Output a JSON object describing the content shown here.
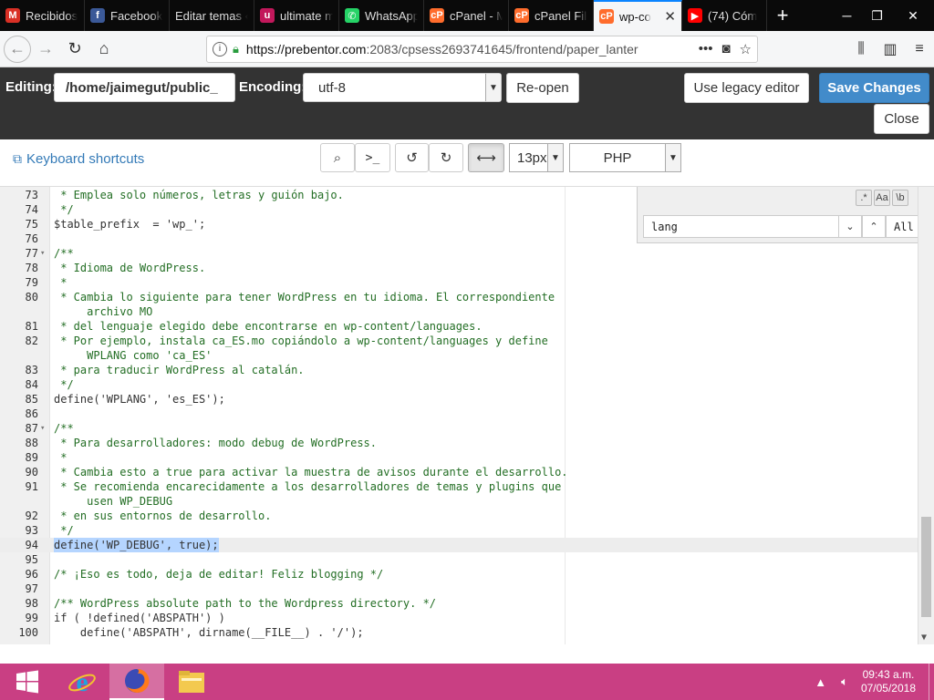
{
  "browser": {
    "tabs": [
      {
        "label": "Recibidos",
        "icon": "gmail-icon",
        "color": "#d93025",
        "glyph": "M"
      },
      {
        "label": "Facebook",
        "icon": "facebook-icon",
        "color": "#3b5998",
        "glyph": "f"
      },
      {
        "label": "Editar temas ‹",
        "icon": "",
        "color": "",
        "glyph": ""
      },
      {
        "label": "ultimate m",
        "icon": "ultimate-icon",
        "color": "#c2185b",
        "glyph": "u"
      },
      {
        "label": "WhatsApp",
        "icon": "whatsapp-icon",
        "color": "#25d366",
        "glyph": "✆"
      },
      {
        "label": "cPanel - M",
        "icon": "cpanel-icon",
        "color": "#ff6c2c",
        "glyph": "cP"
      },
      {
        "label": "cPanel File",
        "icon": "cpanel-icon",
        "color": "#ff6c2c",
        "glyph": "cP"
      },
      {
        "label": "wp-co",
        "icon": "cpanel-icon",
        "color": "#ff6c2c",
        "glyph": "cP",
        "active": true
      },
      {
        "label": "(74) Cóm",
        "icon": "youtube-icon",
        "color": "#ff0000",
        "glyph": "▶"
      }
    ],
    "url_host": "https://prebentor.com",
    "url_rest": ":2083/cpsess2693741645/frontend/paper_lanter"
  },
  "editor_header": {
    "editing_label": "Editing:",
    "path_value": "/home/jaimegut/public_",
    "encoding_label": "Encoding:",
    "encoding_value": "utf-8",
    "reopen_label": "Re-open",
    "legacy_label": "Use legacy editor",
    "save_label": "Save Changes",
    "close_label": "Close"
  },
  "toolbar": {
    "shortcuts_label": "Keyboard shortcuts",
    "fontsize_value": "13px",
    "mode_value": "PHP"
  },
  "search": {
    "regex_label": ".*",
    "case_label": "Aa",
    "word_label": "\\b",
    "query": "lang",
    "all_label": "All"
  },
  "code_lines": [
    {
      "num": "73",
      "text": " * Emplea solo números, letras y guión bajo."
    },
    {
      "num": "74",
      "text": " */"
    },
    {
      "num": "75",
      "text": "$table_prefix  = 'wp_';"
    },
    {
      "num": "76",
      "text": ""
    },
    {
      "num": "77",
      "text": "/**",
      "fold": true
    },
    {
      "num": "78",
      "text": " * Idioma de WordPress."
    },
    {
      "num": "79",
      "text": " *"
    },
    {
      "num": "80",
      "text": " * Cambia lo siguiente para tener WordPress en tu idioma. El correspondiente"
    },
    {
      "num": "",
      "text": "     archivo MO"
    },
    {
      "num": "81",
      "text": " * del lenguaje elegido debe encontrarse en wp-content/languages."
    },
    {
      "num": "82",
      "text": " * Por ejemplo, instala ca_ES.mo copiándolo a wp-content/languages y define"
    },
    {
      "num": "",
      "text": "     WPLANG como 'ca_ES'"
    },
    {
      "num": "83",
      "text": " * para traducir WordPress al catalán."
    },
    {
      "num": "84",
      "text": " */"
    },
    {
      "num": "85",
      "text": "define('WPLANG', 'es_ES');"
    },
    {
      "num": "86",
      "text": ""
    },
    {
      "num": "87",
      "text": "/**",
      "fold": true
    },
    {
      "num": "88",
      "text": " * Para desarrolladores: modo debug de WordPress."
    },
    {
      "num": "89",
      "text": " *"
    },
    {
      "num": "90",
      "text": " * Cambia esto a true para activar la muestra de avisos durante el desarrollo."
    },
    {
      "num": "91",
      "text": " * Se recomienda encarecidamente a los desarrolladores de temas y plugins que"
    },
    {
      "num": "",
      "text": "     usen WP_DEBUG"
    },
    {
      "num": "92",
      "text": " * en sus entornos de desarrollo."
    },
    {
      "num": "93",
      "text": " */"
    },
    {
      "num": "94",
      "text": "define('WP_DEBUG', true);",
      "highlight": true
    },
    {
      "num": "95",
      "text": ""
    },
    {
      "num": "96",
      "text": "/* ¡Eso es todo, deja de editar! Feliz blogging */"
    },
    {
      "num": "97",
      "text": ""
    },
    {
      "num": "98",
      "text": "/** WordPress absolute path to the Wordpress directory. */"
    },
    {
      "num": "99",
      "text": "if ( !defined('ABSPATH') )"
    },
    {
      "num": "100",
      "text": "    define('ABSPATH', dirname(__FILE__) . '/');"
    }
  ],
  "taskbar": {
    "time": "09:43 a.m.",
    "date": "07/05/2018"
  },
  "colors": {
    "header_bg": "#333333",
    "primary": "#428bca",
    "link": "#337ab7",
    "comment": "#236e24",
    "taskbar": "#c93f83"
  }
}
